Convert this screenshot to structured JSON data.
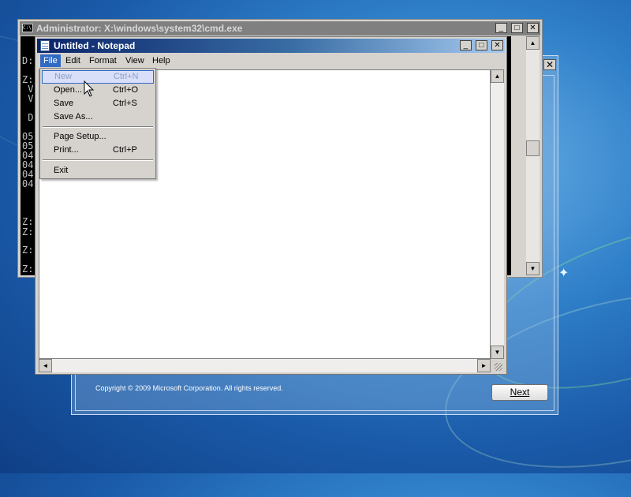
{
  "cmd_window": {
    "title": "Administrator: X:\\windows\\system32\\cmd.exe",
    "icon_text": "C:\\",
    "lines": [
      "D:",
      "Z:",
      " V",
      " V",
      " D",
      "05",
      "05",
      "04",
      "04",
      "04",
      "04",
      "Z:",
      "Z:",
      "Z:",
      "Z:"
    ]
  },
  "notepad": {
    "title": "Untitled - Notepad",
    "menu": [
      "File",
      "Edit",
      "Format",
      "View",
      "Help"
    ],
    "file_menu": {
      "items": [
        {
          "label": "New",
          "shortcut": "Ctrl+N"
        },
        {
          "label": "Open...",
          "shortcut": "Ctrl+O"
        },
        {
          "label": "Save",
          "shortcut": "Ctrl+S"
        },
        {
          "label": "Save As...",
          "shortcut": ""
        },
        {
          "label": "Page Setup...",
          "shortcut": ""
        },
        {
          "label": "Print...",
          "shortcut": "Ctrl+P"
        },
        {
          "label": "Exit",
          "shortcut": ""
        }
      ]
    }
  },
  "setup_window": {
    "copyright": "Copyright © 2009 Microsoft Corporation. All rights reserved.",
    "next_label": "Next",
    "close_glyph": "✕"
  },
  "window_controls": {
    "minimize": "_",
    "maximize": "□",
    "close": "✕"
  },
  "scroll_arrows": {
    "up": "▲",
    "down": "▼",
    "left": "◄",
    "right": "►"
  },
  "icons": [
    "cmd-icon",
    "notepad-icon",
    "mouse-cursor-icon",
    "minimize-icon",
    "maximize-icon",
    "close-icon"
  ],
  "colors": {
    "accent": "#316ac5",
    "titlebar_active": "#0a246a",
    "desktop": "#2f7fc9"
  }
}
